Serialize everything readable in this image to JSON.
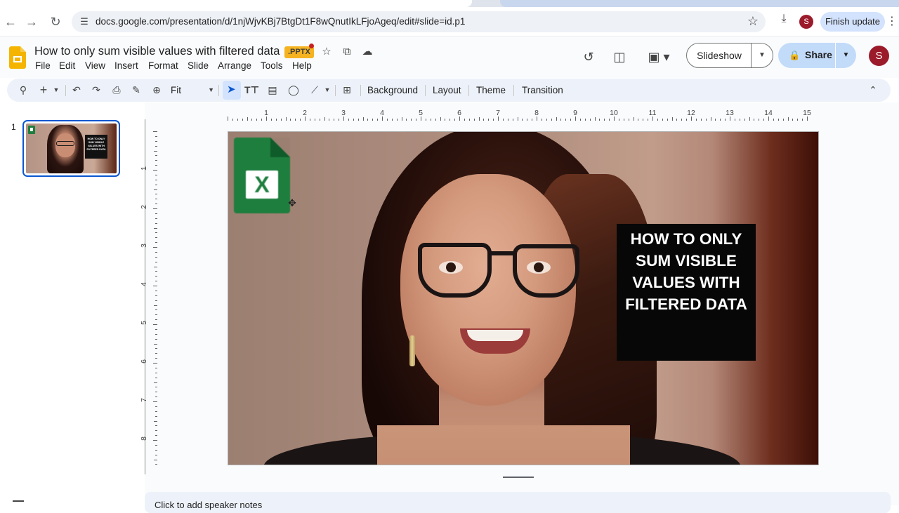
{
  "browser": {
    "url": "docs.google.com/presentation/d/1njWjvKBj7BtgDt1F8wQnutIkLFjoAgeq/edit#slide=id.p1",
    "finish_update": "Finish update",
    "profile_initial": "S"
  },
  "doc": {
    "title": "How to only sum visible values with filtered data",
    "badge": ".PPTX",
    "account_initial": "S"
  },
  "menu": [
    "File",
    "Edit",
    "View",
    "Insert",
    "Format",
    "Slide",
    "Arrange",
    "Tools",
    "Help"
  ],
  "header_buttons": {
    "slideshow": "Slideshow",
    "share": "Share"
  },
  "toolbar": {
    "zoom": "Fit",
    "background": "Background",
    "layout": "Layout",
    "theme": "Theme",
    "transition": "Transition"
  },
  "ruler": {
    "horizontal": [
      "1",
      "2",
      "3",
      "4",
      "5",
      "6",
      "7",
      "8",
      "9",
      "10",
      "11",
      "12",
      "13",
      "14",
      "15"
    ],
    "vertical": [
      "1",
      "2",
      "3",
      "4",
      "5",
      "6",
      "7",
      "8"
    ]
  },
  "filmstrip": {
    "slide_number": "1",
    "thumb_text": "HOW TO ONLY SUM VISIBLE VALUES WITH FILTERED DATA"
  },
  "slide": {
    "title_text": "HOW TO ONLY\nSUM VISIBLE\nVALUES WITH\nFILTERED DATA",
    "excel_letter": "X"
  },
  "notes": {
    "placeholder": "Click to add speaker notes"
  },
  "icons": {
    "back": "arrow-left-icon",
    "forward": "arrow-right-icon",
    "reload": "reload-icon",
    "star": "star-icon",
    "download": "download-icon"
  }
}
